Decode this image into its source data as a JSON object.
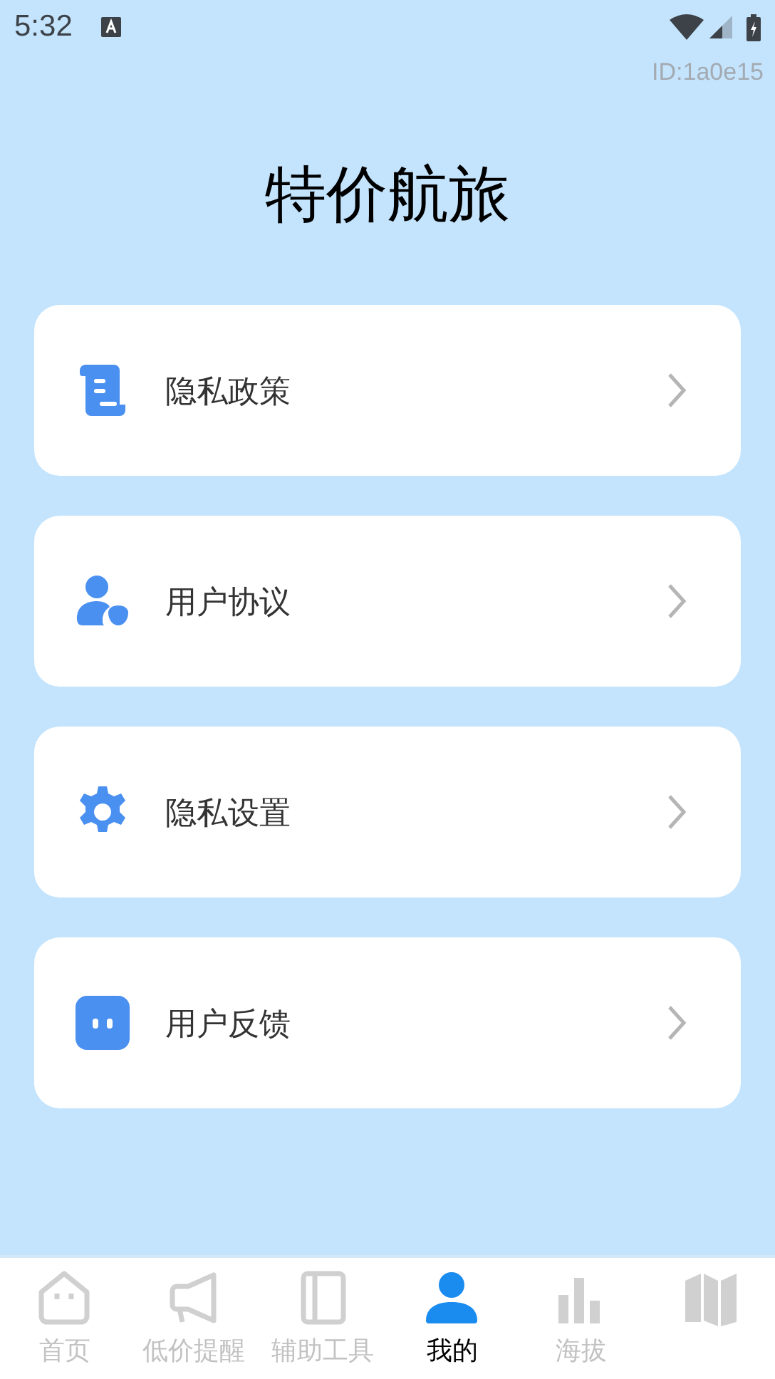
{
  "status_bar": {
    "time": "5:32"
  },
  "user_id": "ID:1a0e15",
  "title": "特价航旅",
  "menu": [
    {
      "kind": "scroll",
      "label": "隐私政策"
    },
    {
      "kind": "user",
      "label": "用户协议"
    },
    {
      "kind": "gear",
      "label": "隐私设置"
    },
    {
      "kind": "chat",
      "label": "用户反馈"
    }
  ],
  "tabs": [
    {
      "kind": "home",
      "label": "首页",
      "selected": false
    },
    {
      "kind": "megaphone",
      "label": "低价提醒",
      "selected": false
    },
    {
      "kind": "book",
      "label": "辅助工具",
      "selected": false
    },
    {
      "kind": "person",
      "label": "我的",
      "selected": true
    },
    {
      "kind": "bars",
      "label": "海拔",
      "selected": false
    },
    {
      "kind": "map",
      "selected": false
    }
  ]
}
